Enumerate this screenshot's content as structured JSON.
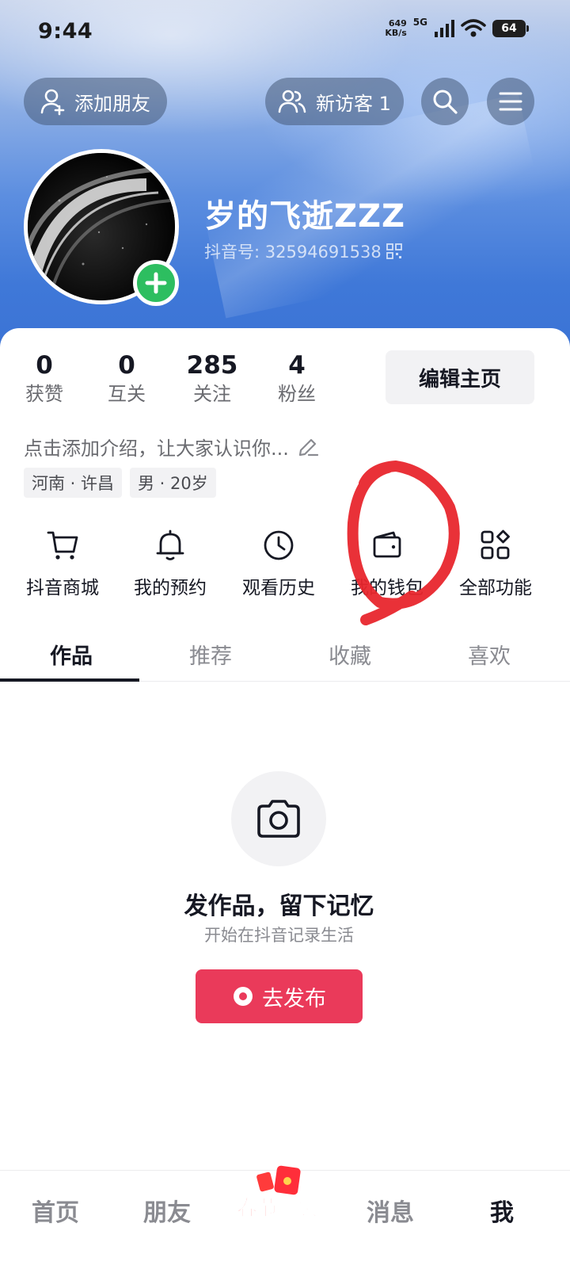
{
  "status_bar": {
    "time": "9:44",
    "net_speed_value": "649",
    "net_speed_unit": "KB/s",
    "network_type": "5G",
    "battery": "64"
  },
  "header": {
    "add_friend_label": "添加朋友",
    "visitors_label": "新访客 1",
    "search_icon": "search-icon",
    "menu_icon": "menu-icon"
  },
  "profile": {
    "nickname": "岁的飞逝ZZZ",
    "douyin_id": "抖音号: 32594691538",
    "avatar_icon": "avatar",
    "stats": [
      {
        "value": "0",
        "label": "获赞"
      },
      {
        "value": "0",
        "label": "互关"
      },
      {
        "value": "285",
        "label": "关注"
      },
      {
        "value": "4",
        "label": "粉丝"
      }
    ],
    "edit_label": "编辑主页",
    "bio_placeholder": "点击添加介绍，让大家认识你...",
    "tags": [
      "河南 · 许昌",
      "男 · 20岁"
    ]
  },
  "shortcuts": [
    {
      "label": "抖音商城",
      "icon": "cart-icon"
    },
    {
      "label": "我的预约",
      "icon": "bell-icon"
    },
    {
      "label": "观看历史",
      "icon": "clock-icon"
    },
    {
      "label": "我的钱包",
      "icon": "wallet-icon"
    },
    {
      "label": "全部功能",
      "icon": "grid-icon"
    }
  ],
  "tabs": [
    {
      "label": "作品",
      "active": true
    },
    {
      "label": "推荐",
      "active": false
    },
    {
      "label": "收藏",
      "active": false
    },
    {
      "label": "喜欢",
      "active": false
    }
  ],
  "empty_state": {
    "icon": "camera-icon",
    "title": "发作品，留下记忆",
    "subtitle": "开始在抖音记录生活",
    "button_label": "去发布"
  },
  "bottom_nav": [
    {
      "label": "首页",
      "active": false
    },
    {
      "label": "朋友",
      "active": false
    },
    {
      "label": "春节赚钱",
      "active": false
    },
    {
      "label": "消息",
      "active": false
    },
    {
      "label": "我",
      "active": true
    }
  ],
  "colors": {
    "accent_red": "#ea3a5a",
    "green_add": "#2dbe60",
    "annotation_red": "#e8262d"
  }
}
